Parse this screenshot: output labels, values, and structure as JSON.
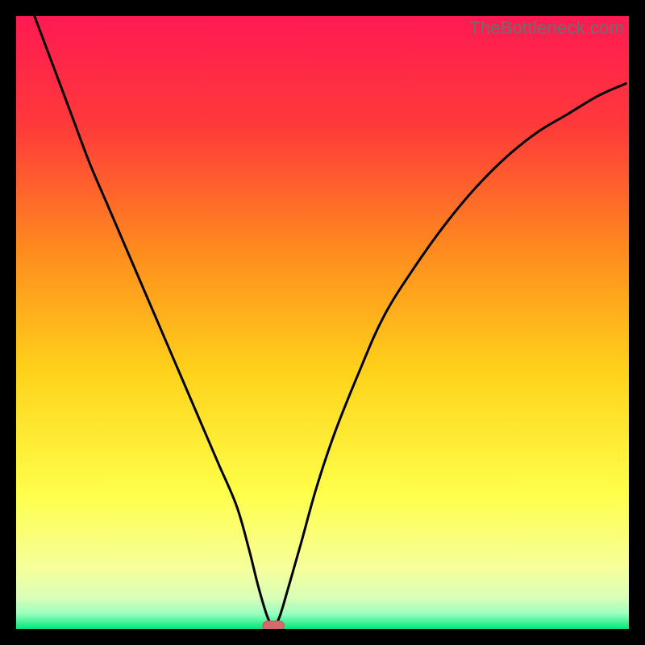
{
  "watermark": "TheBottleneck.com",
  "colors": {
    "frame": "#000000",
    "gradient_top": "#ff1a52",
    "gradient_mid1": "#ff6a1e",
    "gradient_mid2": "#ffd21a",
    "gradient_mid3": "#ffff6a",
    "gradient_mid4": "#f2ffb4",
    "gradient_bottom": "#00e87a",
    "curve": "#000000",
    "marker_fill": "#d46a6a",
    "marker_stroke": "#c85a5a"
  },
  "chart_data": {
    "type": "line",
    "title": "",
    "xlabel": "",
    "ylabel": "",
    "xlim": [
      0,
      100
    ],
    "ylim": [
      0,
      100
    ],
    "categories_note": "No tick labels present; values estimated from pixel positions on a 0–100 normalized scale.",
    "series": [
      {
        "name": "curve",
        "x": [
          3,
          6,
          9,
          12,
          15,
          18,
          21,
          24,
          27,
          30,
          33,
          36,
          38,
          39.5,
          41,
          42,
          43,
          44.5,
          46.5,
          49,
          52,
          56,
          60,
          65,
          70,
          75,
          80,
          85,
          90,
          95,
          99.5
        ],
        "y": [
          100,
          92,
          84,
          76,
          69,
          62,
          55,
          48,
          41,
          34,
          27,
          20,
          13,
          7,
          2,
          0.5,
          2,
          7,
          14,
          23,
          32,
          42,
          51,
          59,
          66,
          72,
          77,
          81,
          84,
          87,
          89
        ]
      }
    ],
    "marker": {
      "x": 42,
      "y": 0.5,
      "width": 3.5,
      "height": 1.6
    },
    "annotations": []
  }
}
